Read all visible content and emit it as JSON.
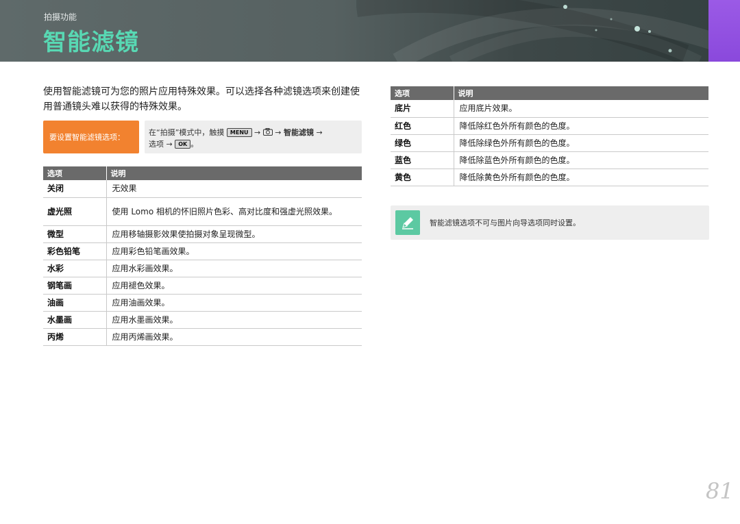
{
  "header": {
    "section_label": "拍摄功能",
    "title": "智能滤镜"
  },
  "intro": "使用智能滤镜可为您的照片应用特殊效果。可以选择各种滤镜选项来创建使用普通镜头难以获得的特殊效果。",
  "instruction": {
    "label": "要设置智能滤镜选项：",
    "text_before_menu": "在“拍摄”模式中，触摸",
    "menu_key": "MENU",
    "arrow1": "→",
    "arrow2": "→",
    "filter_item": "智能滤镜",
    "arrow3": "→",
    "option_text": "选项",
    "arrow4": "→",
    "ok_key": "OK",
    "period": "。"
  },
  "table_headers": {
    "option": "选项",
    "description": "说明"
  },
  "left_table": [
    {
      "option": "关闭",
      "description": "无效果"
    },
    {
      "option": "虚光照",
      "description": "使用 Lomo 相机的怀旧照片色彩、高对比度和强虚光照效果。"
    },
    {
      "option": "微型",
      "description": "应用移轴摄影效果使拍摄对象呈现微型。"
    },
    {
      "option": "彩色铅笔",
      "description": "应用彩色铅笔画效果。"
    },
    {
      "option": "水彩",
      "description": "应用水彩画效果。"
    },
    {
      "option": "钢笔画",
      "description": "应用褪色效果。"
    },
    {
      "option": "油画",
      "description": "应用油画效果。"
    },
    {
      "option": "水墨画",
      "description": "应用水墨画效果。"
    },
    {
      "option": "丙烯",
      "description": "应用丙烯画效果。"
    }
  ],
  "right_table": [
    {
      "option": "底片",
      "description": "应用底片效果。"
    },
    {
      "option": "红色",
      "description": "降低除红色外所有颜色的色度。"
    },
    {
      "option": "绿色",
      "description": "降低除绿色外所有颜色的色度。"
    },
    {
      "option": "蓝色",
      "description": "降低除蓝色外所有颜色的色度。"
    },
    {
      "option": "黄色",
      "description": "降低除黄色外所有颜色的色度。"
    }
  ],
  "note": {
    "icon": "pencil-note-icon",
    "text": "智能滤镜选项不可与图片向导选项同时设置。"
  },
  "page_number": "81",
  "colors": {
    "title_accent": "#58d8b3",
    "instruction_label_bg": "#f2822f",
    "side_tab": "#9b5ae6",
    "note_icon_bg": "#5cc9a2"
  }
}
